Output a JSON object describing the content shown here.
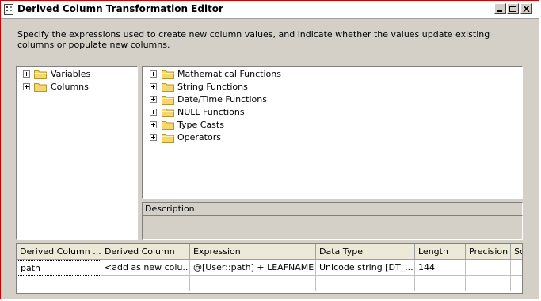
{
  "window": {
    "title": "Derived Column Transformation Editor",
    "icons": [
      "app-icon",
      "minimize-icon",
      "maximize-icon",
      "close-icon"
    ]
  },
  "instructions": "Specify the expressions used to create new column values, and indicate whether the values update existing columns or populate new columns.",
  "left_tree": {
    "items": [
      {
        "label": "Variables",
        "icon": "folder-icon"
      },
      {
        "label": "Columns",
        "icon": "folder-icon"
      }
    ]
  },
  "right_tree": {
    "items": [
      {
        "label": "Mathematical Functions"
      },
      {
        "label": "String Functions"
      },
      {
        "label": "Date/Time Functions"
      },
      {
        "label": "NULL Functions"
      },
      {
        "label": "Type Casts"
      },
      {
        "label": "Operators"
      }
    ]
  },
  "description": {
    "label": "Description:"
  },
  "grid": {
    "columns": [
      "Derived Column ...",
      "Derived Column",
      "Expression",
      "Data Type",
      "Length",
      "Precision",
      "Sc"
    ],
    "rows": [
      [
        "path",
        "<add as new colu...",
        "@[User::path] + LEAFNAME",
        "Unicode string [DT_...",
        "144",
        "",
        ""
      ]
    ]
  },
  "colors": {
    "frame_border": "#cc0000",
    "dialog_background": "#d4d0c8",
    "folder_yellow": "#f5d76e"
  }
}
